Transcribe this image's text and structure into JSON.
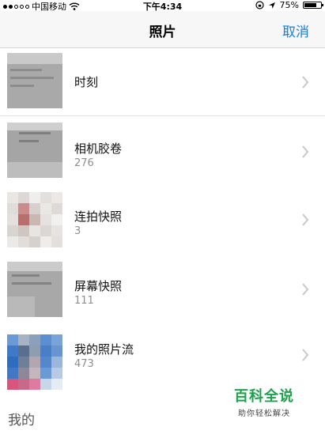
{
  "status_bar": {
    "carrier": "中国移动",
    "time": "下午4:34",
    "battery_percent": "75%",
    "battery_level": 0.75,
    "signal_bars": 2
  },
  "nav": {
    "title": "照片",
    "cancel_label": "取消"
  },
  "albums": [
    {
      "name": "时刻",
      "count": ""
    },
    {
      "name": "相机胶卷",
      "count": "276"
    },
    {
      "name": "连拍快照",
      "count": "3"
    },
    {
      "name": "屏幕快照",
      "count": "111"
    },
    {
      "name": "我的照片流",
      "count": "473"
    }
  ],
  "section_header": "我的",
  "watermark": {
    "title": "百科全说",
    "subtitle": "助你轻松解决"
  },
  "colors": {
    "accent": "#1a7de3",
    "watermark_green": "#1aa34a"
  }
}
